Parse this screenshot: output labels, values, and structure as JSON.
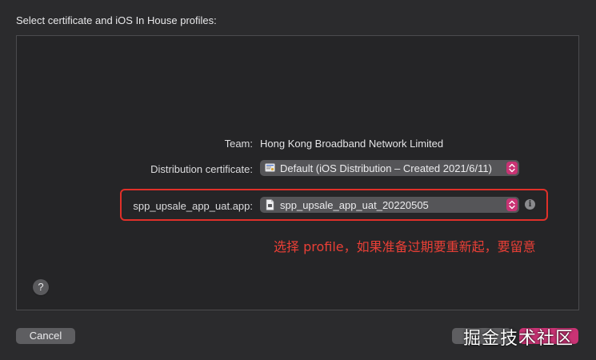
{
  "dialog": {
    "heading": "Select certificate and iOS In House profiles:"
  },
  "form": {
    "team_label": "Team:",
    "team_value": "Hong Kong Broadband Network Limited",
    "certificate_label": "Distribution certificate:",
    "certificate_value": "Default (iOS Distribution – Created 2021/6/11)",
    "profile_label": "spp_upsale_app_uat.app:",
    "profile_value": "spp_upsale_app_uat_20220505",
    "info_glyph": "i"
  },
  "annotation": {
    "text": "选择 profile，如果准备过期要重新起，要留意",
    "color": "#ea3f36"
  },
  "footer": {
    "help_glyph": "?",
    "cancel_label": "Cancel",
    "watermark": "掘金技术社区"
  },
  "colors": {
    "accent": "#c93374",
    "background": "#2b2b2d",
    "highlight": "#e03029"
  },
  "icons": {
    "certificate": "certificate-icon",
    "profile": "document-icon",
    "info": "info-icon",
    "help": "help-icon"
  }
}
